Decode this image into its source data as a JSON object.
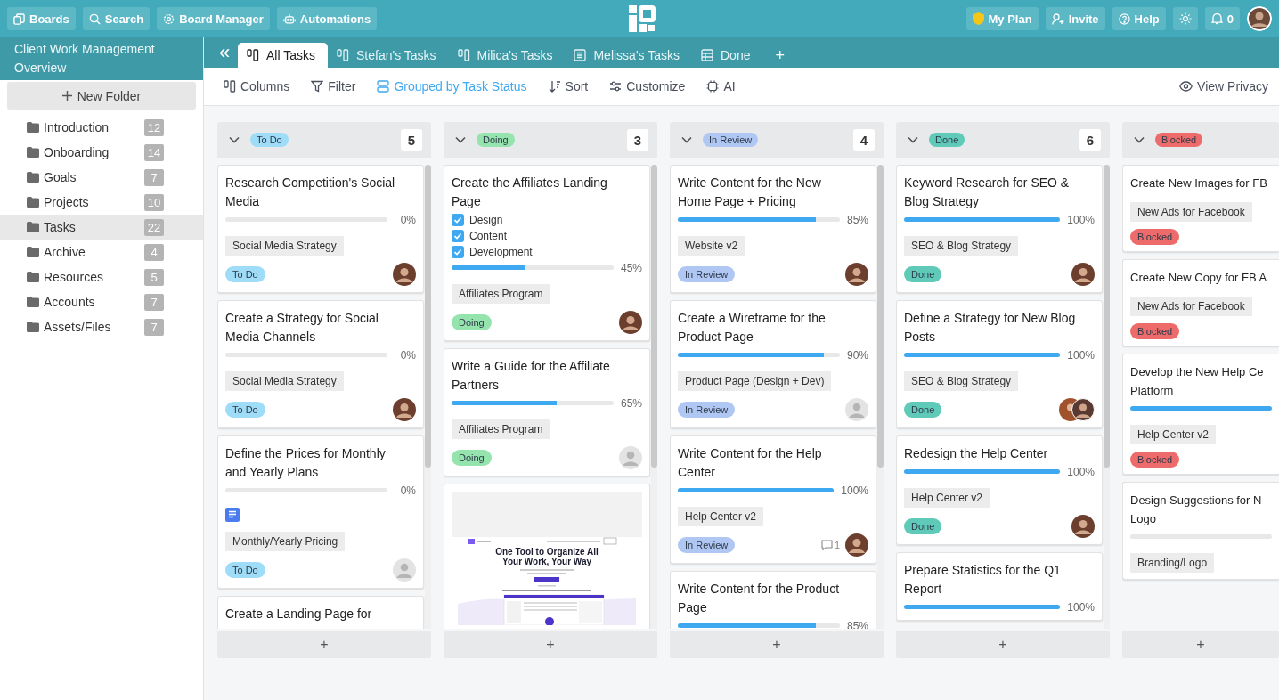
{
  "top_nav": [
    {
      "label": "Boards"
    },
    {
      "label": "Search"
    },
    {
      "label": "Board Manager"
    },
    {
      "label": "Automations"
    }
  ],
  "top_right": [
    {
      "label": "My Plan"
    },
    {
      "label": "Invite"
    },
    {
      "label": "Help"
    }
  ],
  "notifications": "0",
  "sidebar": {
    "title": "Client Work Management Overview",
    "new_folder": "New Folder",
    "folders": [
      {
        "name": "Introduction",
        "count": "12",
        "selected": false
      },
      {
        "name": "Onboarding",
        "count": "14",
        "selected": false
      },
      {
        "name": "Goals",
        "count": "7",
        "selected": false
      },
      {
        "name": "Projects",
        "count": "10",
        "selected": false
      },
      {
        "name": "Tasks",
        "count": "22",
        "selected": true
      },
      {
        "name": "Archive",
        "count": "4",
        "selected": false
      },
      {
        "name": "Resources",
        "count": "5",
        "selected": false
      },
      {
        "name": "Accounts",
        "count": "7",
        "selected": false
      },
      {
        "name": "Assets/Files",
        "count": "7",
        "selected": false
      }
    ]
  },
  "collapse": "«",
  "tabs": [
    {
      "label": "All Tasks",
      "selected": true
    },
    {
      "label": "Stefan's Tasks",
      "selected": false
    },
    {
      "label": "Milica's Tasks",
      "selected": false
    },
    {
      "label": "Melissa's Tasks",
      "selected": false
    },
    {
      "label": "Done",
      "selected": false
    }
  ],
  "add_tab": "+",
  "toolbar": [
    {
      "label": "Columns",
      "selected": false
    },
    {
      "label": "Filter",
      "selected": false
    },
    {
      "label": "Grouped by Task Status",
      "selected": true
    },
    {
      "label": "Sort",
      "selected": false
    },
    {
      "label": "Customize",
      "selected": false
    },
    {
      "label": "AI",
      "selected": false
    }
  ],
  "view_privacy": "View Privacy",
  "columns": [
    {
      "status": "To Do",
      "color": "#9fdcf7",
      "count": "5",
      "add": "+",
      "cards": [
        {
          "kind": "task",
          "title": "Research Competition's Social Media",
          "level": 0,
          "percent": "0%",
          "tag": "Social Media Strategy",
          "status": "To Do",
          "assignee": {
            "kind": "photo"
          }
        },
        {
          "kind": "task",
          "title": "Create a Strategy for Social Media Channels",
          "level": 0,
          "percent": "0%",
          "tag": "Social Media Strategy",
          "status": "To Do",
          "assignee": {
            "kind": "photo"
          }
        },
        {
          "kind": "task",
          "title": "Define the Prices for Monthly and Yearly Plans",
          "level": 0,
          "percent": "0%",
          "doc": true,
          "tag": "Monthly/Yearly Pricing",
          "status": "To Do",
          "assignee": {
            "kind": "empty"
          }
        },
        {
          "kind": "task",
          "title": "Create a Landing Page for"
        }
      ]
    },
    {
      "status": "Doing",
      "color": "#95e3ad",
      "count": "3",
      "add": "+",
      "cards": [
        {
          "kind": "task",
          "title": "Create the Affiliates Landing Page",
          "checklist": [
            {
              "label": "Design",
              "checked": true
            },
            {
              "label": "Content",
              "checked": true
            },
            {
              "label": "Development",
              "checked": true
            }
          ],
          "level": 0.45,
          "percent": "45%",
          "tag": "Affiliates Program",
          "status": "Doing",
          "assignee": {
            "kind": "photo"
          }
        },
        {
          "kind": "task",
          "title": "Write a Guide for the Affiliate Partners",
          "level": 0.65,
          "percent": "65%",
          "tag": "Affiliates Program",
          "status": "Doing",
          "assignee": {
            "kind": "empty"
          }
        },
        {
          "kind": "screenshot",
          "headline": "One Tool to Organize All Your Work, Your Way"
        }
      ]
    },
    {
      "status": "In Review",
      "color": "#b0c7f3",
      "count": "4",
      "add": "+",
      "cards": [
        {
          "kind": "task",
          "title": "Write Content for the New Home Page + Pricing",
          "level": 0.85,
          "percent": "85%",
          "tag": "Website v2",
          "status": "In Review",
          "assignee": {
            "kind": "photo"
          }
        },
        {
          "kind": "task",
          "title": "Create a Wireframe for the Product Page",
          "level": 0.9,
          "percent": "90%",
          "tag": "Product Page (Design + Dev)",
          "status": "In Review",
          "assignee": {
            "kind": "empty"
          }
        },
        {
          "kind": "task",
          "title": "Write Content for the Help Center",
          "level": 1,
          "percent": "100%",
          "tag": "Help Center v2",
          "status": "In Review",
          "assignee": {
            "kind": "photo"
          },
          "comments": "1"
        },
        {
          "kind": "task",
          "title": "Write Content for the Product Page",
          "level": 0.85,
          "percent": "85%"
        }
      ]
    },
    {
      "status": "Done",
      "color": "#5fcab7",
      "count": "6",
      "add": "+",
      "cards": [
        {
          "kind": "task",
          "title": "Keyword Research for SEO & Blog Strategy",
          "level": 1,
          "percent": "100%",
          "tag": "SEO & Blog Strategy",
          "status": "Done",
          "assignee": {
            "kind": "photo"
          }
        },
        {
          "kind": "task",
          "title": "Define a Strategy for New Blog Posts",
          "level": 1,
          "percent": "100%",
          "tag": "SEO & Blog Strategy",
          "status": "Done",
          "assignee": {
            "kind": "pair"
          }
        },
        {
          "kind": "task",
          "title": "Redesign the Help Center",
          "level": 1,
          "percent": "100%",
          "tag": "Help Center v2",
          "status": "Done",
          "assignee": {
            "kind": "photo"
          }
        },
        {
          "kind": "task",
          "title": "Prepare Statistics for the Q1 Report",
          "level": 1,
          "percent": "100%"
        }
      ]
    },
    {
      "status": "Blocked",
      "color": "#ee6b6b",
      "add": "+",
      "cards": [
        {
          "kind": "cut",
          "title_lines": [
            "Create New Images for FB"
          ],
          "tag": "New Ads for Facebook",
          "status": "Blocked"
        },
        {
          "kind": "cut",
          "title_lines": [
            "Create New Copy for FB A"
          ],
          "tag": "New Ads for Facebook",
          "status": "Blocked"
        },
        {
          "kind": "cut",
          "title_lines": [
            "Develop the New Help Ce",
            "Platform"
          ],
          "level": 1,
          "tag": "Help Center v2",
          "status": "Blocked"
        },
        {
          "kind": "cut",
          "title_lines": [
            "Design Suggestions for N",
            "Logo"
          ],
          "level": 0,
          "tag": "Branding/Logo"
        }
      ]
    }
  ]
}
